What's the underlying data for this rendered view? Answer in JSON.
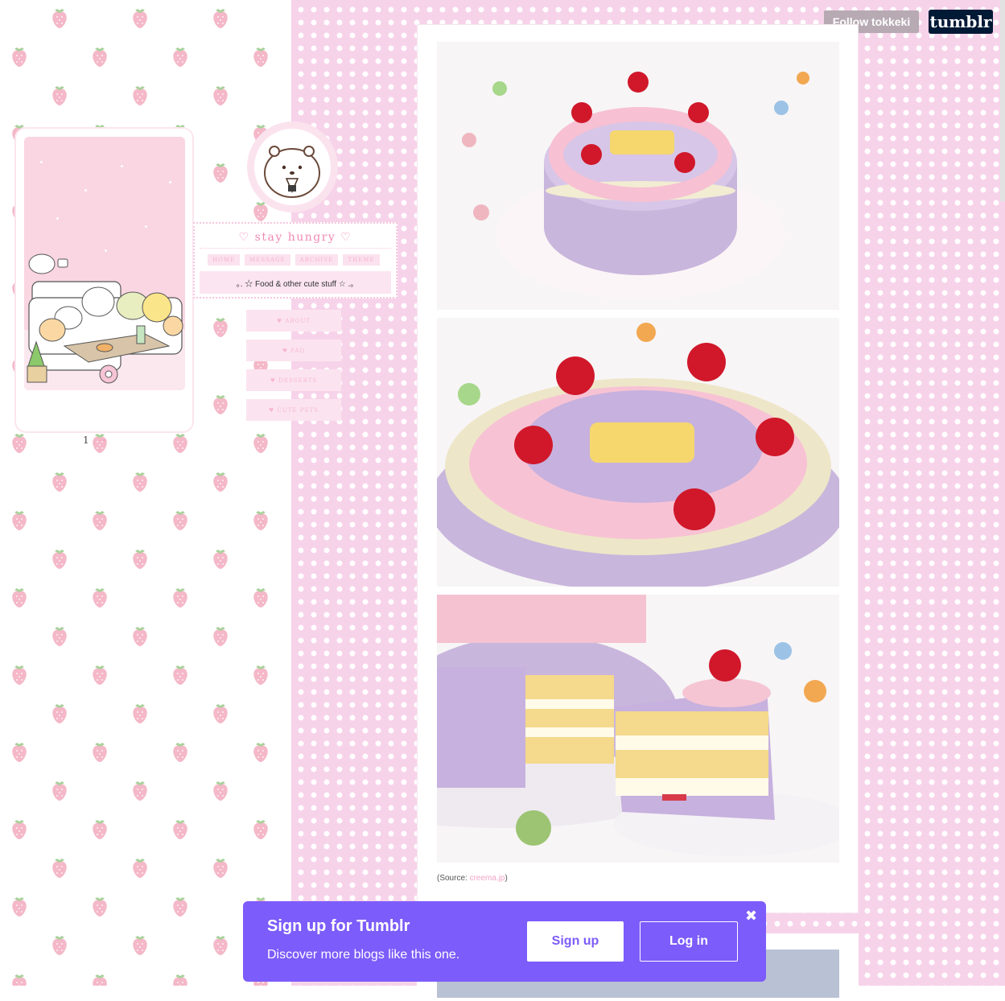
{
  "topbar": {
    "follow_label": "Follow tokkeki",
    "logo_text": "tumblr"
  },
  "sidebar": {
    "pagination_current": "1",
    "pagination_next": "→"
  },
  "header": {
    "title": "♡ stay hungry ♡",
    "nav": [
      "home",
      "message",
      "archive",
      "theme"
    ],
    "description": "｡. ☆ Food & other cute stuff ☆ .｡"
  },
  "side_links": [
    "♥ about",
    "♥ faq",
    "♥ desserts",
    "♥ cute pets"
  ],
  "post": {
    "caption_prefix": "(Source: ",
    "caption_link": "creema.jp",
    "caption_suffix": ")"
  },
  "signup": {
    "title": "Sign up for Tumblr",
    "subtitle": "Discover more blogs like this one.",
    "signup_label": "Sign up",
    "login_label": "Log in",
    "close_symbol": "✖"
  },
  "colors": {
    "pink_bg": "#f7d3ea",
    "accent_pink": "#f08ab4",
    "signup_purple": "#7c5cfa",
    "tumblr_navy": "#001935"
  }
}
